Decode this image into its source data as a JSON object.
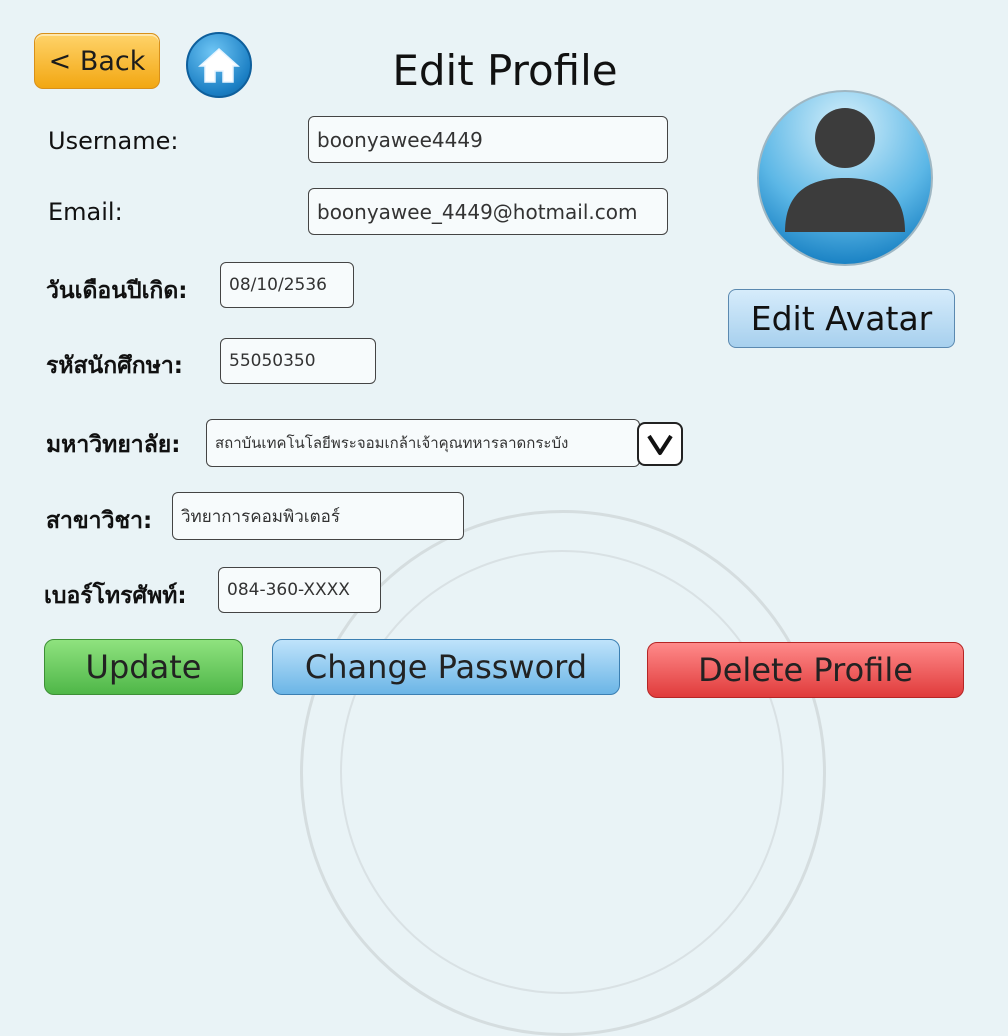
{
  "header": {
    "back_label": "< Back",
    "title": "Edit Profile"
  },
  "form": {
    "username": {
      "label": "Username:",
      "value": "boonyawee4449"
    },
    "email": {
      "label": "Email:",
      "value": "boonyawee_4449@hotmail.com"
    },
    "birthdate": {
      "label": "วันเดือนปีเกิด:",
      "value": "08/10/2536"
    },
    "student_id": {
      "label": "รหัสนักศึกษา:",
      "value": "55050350"
    },
    "university": {
      "label": "มหาวิทยาลัย:",
      "value": "สถาบันเทคโนโลยีพระจอมเกล้าเจ้าคุณทหารลาดกระบัง"
    },
    "major": {
      "label": "สาขาวิชา:",
      "value": "วิทยาการคอมพิวเตอร์"
    },
    "phone": {
      "label": "เบอร์โทรศัพท์:",
      "value": "084-360-XXXX"
    }
  },
  "avatar": {
    "edit_label": "Edit Avatar"
  },
  "actions": {
    "update_label": "Update",
    "change_password_label": "Change Password",
    "delete_label": "Delete Profile"
  },
  "colors": {
    "back": "#f2a712",
    "update": "#4fb748",
    "change_password": "#6bb5e6",
    "delete": "#e03b3b",
    "home": "#1b7fc4"
  }
}
